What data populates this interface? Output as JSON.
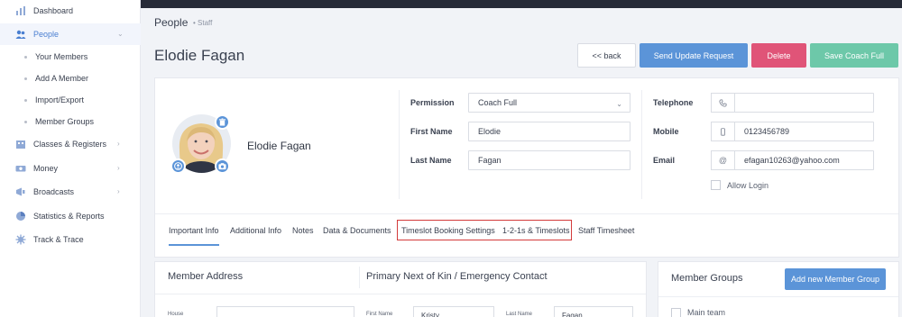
{
  "sidebar": {
    "items": [
      {
        "label": "Dashboard",
        "icon": "chart-bars-icon"
      },
      {
        "label": "People",
        "icon": "people-icon",
        "active": true
      },
      {
        "label": "Classes & Registers",
        "icon": "building-icon"
      },
      {
        "label": "Money",
        "icon": "money-icon"
      },
      {
        "label": "Broadcasts",
        "icon": "megaphone-icon"
      },
      {
        "label": "Statistics & Reports",
        "icon": "pie-chart-icon"
      },
      {
        "label": "Track & Trace",
        "icon": "gear-virus-icon"
      }
    ],
    "people_sub": [
      "Your Members",
      "Add A Member",
      "Import/Export",
      "Member Groups"
    ]
  },
  "header": {
    "section": "People",
    "breadcrumb": "Staff",
    "title": "Elodie Fagan"
  },
  "actions": {
    "back": "<< back",
    "send_update": "Send Update Request",
    "delete": "Delete",
    "save": "Save Coach Full"
  },
  "profile": {
    "name": "Elodie Fagan",
    "permission_label": "Permission",
    "permission_value": "Coach Full",
    "first_name_label": "First Name",
    "first_name_value": "Elodie",
    "last_name_label": "Last Name",
    "last_name_value": "Fagan",
    "telephone_label": "Telephone",
    "telephone_value": "",
    "mobile_label": "Mobile",
    "mobile_value": "0123456789",
    "email_label": "Email",
    "email_value": "efagan10263@yahoo.com",
    "allow_login_label": "Allow Login"
  },
  "tabs": [
    "Important Info",
    "Additional Info",
    "Notes",
    "Data & Documents",
    "Timeslot Booking Settings",
    "1-2-1s & Timeslots",
    "Staff Timesheet"
  ],
  "address": {
    "title": "Member Address",
    "house_label": "House",
    "kin_title": "Primary Next of Kin / Emergency Contact",
    "kin_first_label": "First Name",
    "kin_first_value": "Kristy",
    "kin_last_label": "Last Name",
    "kin_last_value": "Fagan"
  },
  "groups": {
    "title": "Member Groups",
    "add_button": "Add new Member Group",
    "items": [
      "Main team"
    ]
  },
  "colors": {
    "primary": "#5b94d8",
    "danger": "#e05478",
    "success": "#6dc8a9",
    "topbar": "#272b38"
  }
}
